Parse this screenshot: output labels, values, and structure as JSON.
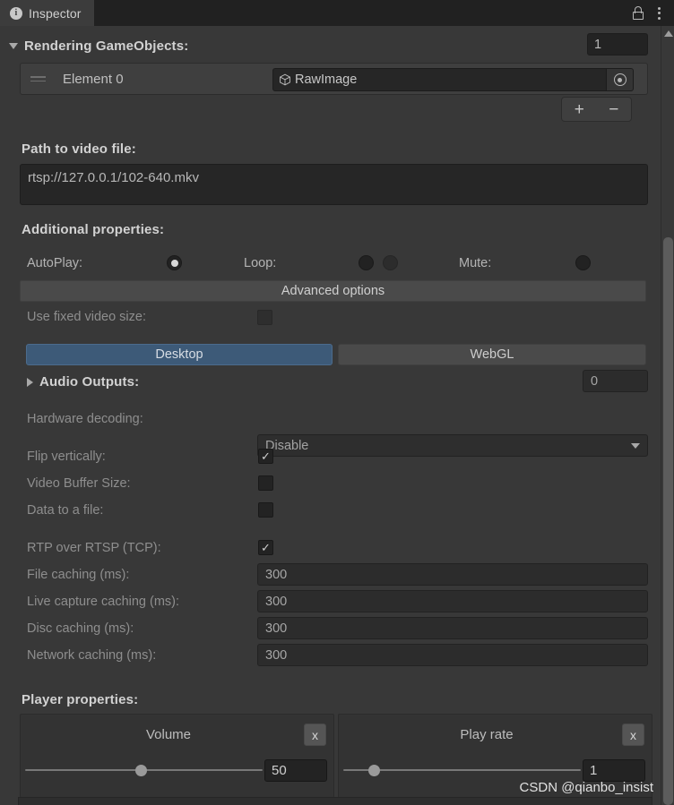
{
  "window": {
    "tab_label": "Inspector",
    "info_icon": "info-icon",
    "lock_icon": "lock-icon",
    "menu_icon": "kebab-menu-icon"
  },
  "rendering": {
    "header": "Rendering GameObjects:",
    "size_value": "1",
    "element_label": "Element 0",
    "element_object": "RawImage",
    "add_label": "+",
    "remove_label": "−"
  },
  "path": {
    "label": "Path to video file:",
    "value": "rtsp://127.0.0.1/102-640.mkv"
  },
  "additional": {
    "header": "Additional properties:",
    "autoplay_label": "AutoPlay:",
    "autoplay_checked": true,
    "loop_label": "Loop:",
    "loop_a_checked": false,
    "loop_b_checked": false,
    "mute_label": "Mute:",
    "mute_checked": false,
    "advanced_button": "Advanced options",
    "fixed_size_label": "Use fixed video size:",
    "fixed_size_checked": false
  },
  "platform_tabs": {
    "desktop": "Desktop",
    "webgl": "WebGL",
    "selected": "Desktop"
  },
  "audio_outputs": {
    "label": "Audio Outputs:",
    "count": "0"
  },
  "hardware": {
    "label": "Hardware decoding:",
    "value": "Disable"
  },
  "toggles": [
    {
      "label": "Flip vertically:",
      "checked": true
    },
    {
      "label": "Video Buffer Size:",
      "checked": false
    },
    {
      "label": "Data to a file:",
      "checked": false
    },
    {
      "label": "RTP over RTSP (TCP):",
      "checked": true
    }
  ],
  "caching": [
    {
      "label": "File caching (ms):",
      "value": "300"
    },
    {
      "label": "Live capture caching (ms):",
      "value": "300"
    },
    {
      "label": "Disc caching (ms):",
      "value": "300"
    },
    {
      "label": "Network caching (ms):",
      "value": "300"
    }
  ],
  "player": {
    "header": "Player properties:",
    "volume": {
      "title": "Volume",
      "value": "50",
      "reset_label": "x",
      "position_pct": 50
    },
    "playrate": {
      "title": "Play rate",
      "value": "1",
      "reset_label": "x",
      "position_pct": 12
    }
  },
  "watermark": "CSDN @qianbo_insist",
  "colors": {
    "background": "#383838",
    "tab_selected": "#3d5a78",
    "tab_unselected": "#4a4a4a",
    "field_background": "#262626"
  }
}
